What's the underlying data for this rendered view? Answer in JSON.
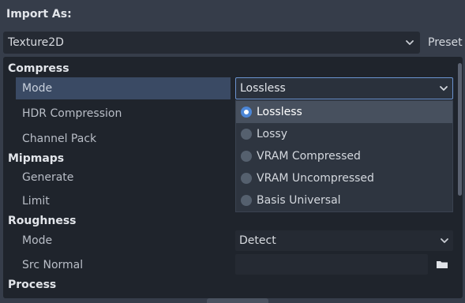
{
  "header": {
    "title": "Import As:"
  },
  "import_as": {
    "value": "Texture2D",
    "preset_label": "Preset"
  },
  "sections": {
    "compress": "Compress",
    "mipmaps": "Mipmaps",
    "roughness": "Roughness",
    "process": "Process"
  },
  "props": {
    "mode": "Mode",
    "hdr_compression": "HDR Compression",
    "channel_pack": "Channel Pack",
    "generate": "Generate",
    "limit": "Limit",
    "roughness_mode": "Mode",
    "src_normal": "Src Normal"
  },
  "compress_mode": {
    "value": "Lossless",
    "options": [
      "Lossless",
      "Lossy",
      "VRAM Compressed",
      "VRAM Uncompressed",
      "Basis Universal"
    ],
    "selected_index": 0
  },
  "roughness_mode": {
    "value": "Detect"
  },
  "colors": {
    "accent": "#4c86d6",
    "highlight_row": "#3a4a64",
    "panel_bg": "#1f242c"
  },
  "icons": {
    "dropdown": "chevron-down-icon",
    "folder": "folder-icon",
    "radio_on": "radio-selected-icon",
    "radio_off": "radio-unselected-icon"
  }
}
